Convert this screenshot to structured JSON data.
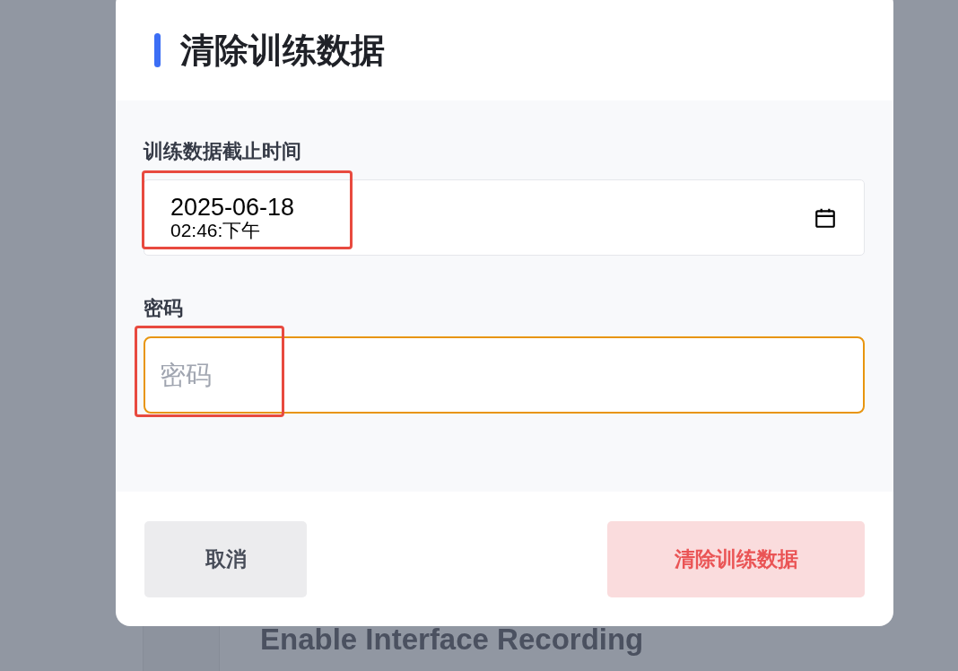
{
  "background": {
    "heading": "Enable Interface Recording"
  },
  "dialog": {
    "title": "清除训练数据",
    "fields": [
      {
        "kind": "datetime",
        "label": "训练数据截止时间",
        "date": "2025-06-18",
        "time": "02:46:下午",
        "highlighted": true,
        "focused": false
      },
      {
        "kind": "password",
        "label": "密码",
        "placeholder": "密码",
        "highlighted": true,
        "focused": true
      }
    ],
    "buttons": [
      {
        "kind": "secondary",
        "label": "取消"
      },
      {
        "kind": "danger",
        "label": "清除训练数据",
        "disabled": true
      }
    ]
  }
}
